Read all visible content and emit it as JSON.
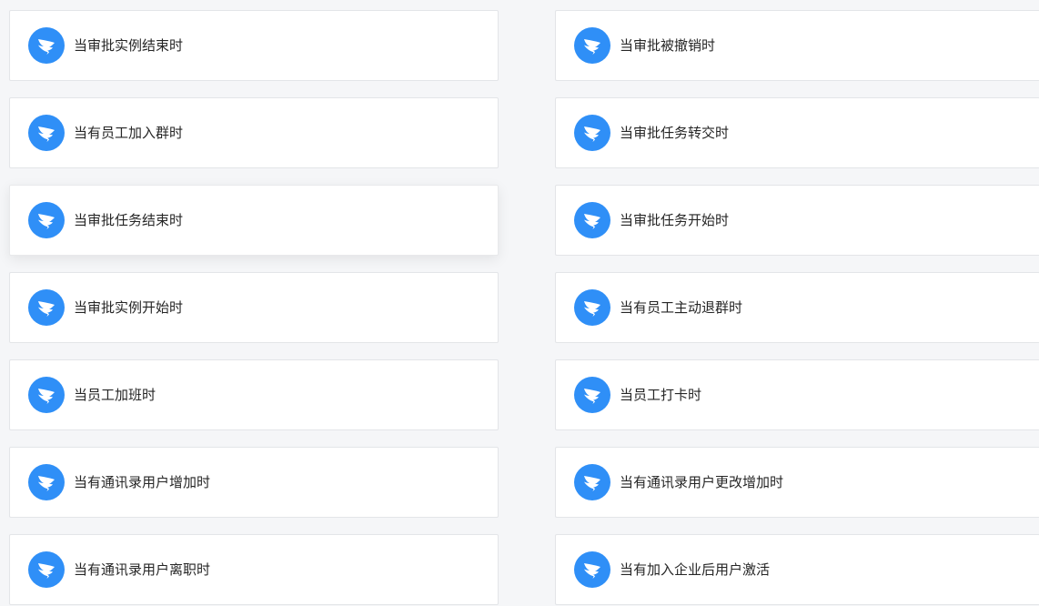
{
  "theme": {
    "background": "#f5f6f8",
    "card_background": "#ffffff",
    "card_border": "#e3e5e8",
    "icon_color": "#2f8ff7",
    "text_color": "#262626"
  },
  "cards": {
    "left": [
      {
        "label": "当审批实例结束时",
        "icon": "dingtalk-wing-icon"
      },
      {
        "label": "当有员工加入群时",
        "icon": "dingtalk-wing-icon"
      },
      {
        "label": "当审批任务结束时",
        "icon": "dingtalk-wing-icon"
      },
      {
        "label": "当审批实例开始时",
        "icon": "dingtalk-wing-icon"
      },
      {
        "label": "当员工加班时",
        "icon": "dingtalk-wing-icon"
      },
      {
        "label": "当有通讯录用户增加时",
        "icon": "dingtalk-wing-icon"
      },
      {
        "label": "当有通讯录用户离职时",
        "icon": "dingtalk-wing-icon"
      }
    ],
    "right": [
      {
        "label": "当审批被撤销时",
        "icon": "dingtalk-wing-icon"
      },
      {
        "label": "当审批任务转交时",
        "icon": "dingtalk-wing-icon"
      },
      {
        "label": "当审批任务开始时",
        "icon": "dingtalk-wing-icon"
      },
      {
        "label": "当有员工主动退群时",
        "icon": "dingtalk-wing-icon"
      },
      {
        "label": "当员工打卡时",
        "icon": "dingtalk-wing-icon"
      },
      {
        "label": "当有通讯录用户更改增加时",
        "icon": "dingtalk-wing-icon"
      },
      {
        "label": "当有加入企业后用户激活",
        "icon": "dingtalk-wing-icon"
      }
    ]
  }
}
